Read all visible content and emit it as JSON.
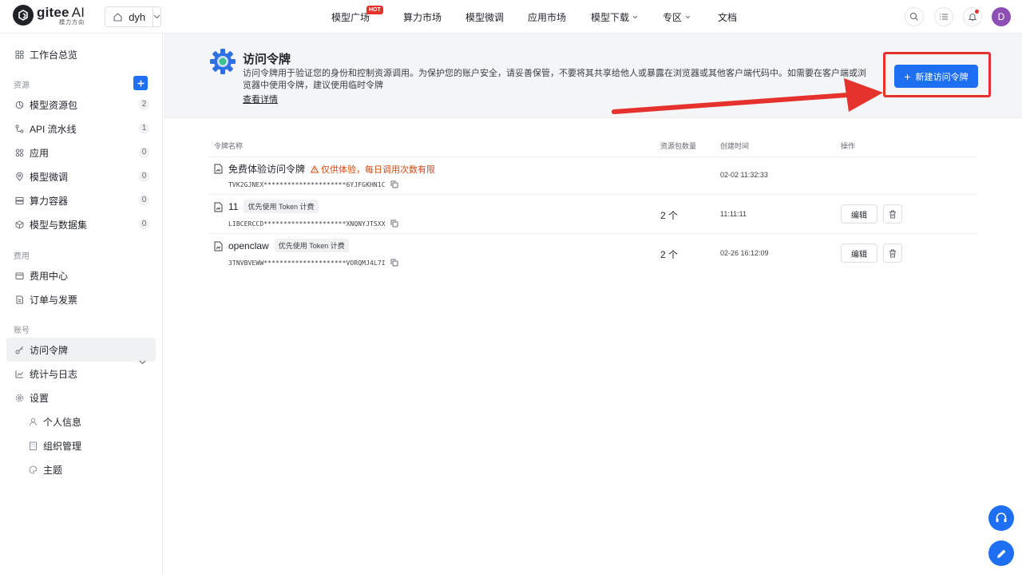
{
  "brand": {
    "name": "gitee",
    "ai": "AI",
    "tagline": "模力方向"
  },
  "workspace": {
    "name": "dyh"
  },
  "nav": {
    "items": [
      {
        "label": "模型广场",
        "hot": "HOT"
      },
      {
        "label": "算力市场"
      },
      {
        "label": "模型微调"
      },
      {
        "label": "应用市场"
      },
      {
        "label": "模型下载"
      },
      {
        "label": "专区"
      },
      {
        "label": "文档"
      }
    ]
  },
  "user": {
    "initial": "D"
  },
  "sidebar": {
    "overview": "工作台总览",
    "sections": {
      "resources": "资源",
      "billing": "费用",
      "account": "账号"
    },
    "resources": [
      {
        "label": "模型资源包",
        "count": "2"
      },
      {
        "label": "API 流水线",
        "count": "1"
      },
      {
        "label": "应用",
        "count": "0"
      },
      {
        "label": "模型微调",
        "count": "0"
      },
      {
        "label": "算力容器",
        "count": "0"
      },
      {
        "label": "模型与数据集",
        "count": "0"
      }
    ],
    "billing": [
      {
        "label": "费用中心"
      },
      {
        "label": "订单与发票"
      }
    ],
    "account": [
      {
        "label": "访问令牌"
      },
      {
        "label": "统计与日志"
      },
      {
        "label": "设置"
      }
    ],
    "settings_sub": [
      {
        "label": "个人信息"
      },
      {
        "label": "组织管理"
      },
      {
        "label": "主题"
      }
    ]
  },
  "header": {
    "title": "访问令牌",
    "description": "访问令牌用于验证您的身份和控制资源调用。为保护您的账户安全，请妥善保管，不要将其共享给他人或暴露在浏览器或其他客户端代码中。如需要在客户端或浏览器中使用令牌，建议使用临时令牌",
    "link": "查看详情",
    "new_button": "新建访问令牌"
  },
  "table": {
    "columns": {
      "name": "令牌名称",
      "packages": "资源包数量",
      "created": "创建时间",
      "actions": "操作"
    },
    "edit_label": "编辑",
    "rows": [
      {
        "name": "免费体验访问令牌",
        "warning": "仅供体验，每日调用次数有限",
        "tag": "",
        "key": "TVK2GJNEX*********************6YJFGKHN1C",
        "packages": "",
        "created": "02-02 11:32:33"
      },
      {
        "name": "11",
        "warning": "",
        "tag": "优先使用 Token 计费",
        "key": "LIBCERCCD*********************XNQNYJTSXX",
        "packages": "2 个",
        "created": "11:11:11"
      },
      {
        "name": "openclaw",
        "warning": "",
        "tag": "优先使用 Token 计费",
        "key": "3TNVBVEWW*********************VORQMJ4L7I",
        "packages": "2 个",
        "created": "02-26 16:12:09"
      }
    ]
  },
  "colors": {
    "primary": "#1e6ff2",
    "highlight": "#e5322d",
    "warning": "#d9480f"
  }
}
